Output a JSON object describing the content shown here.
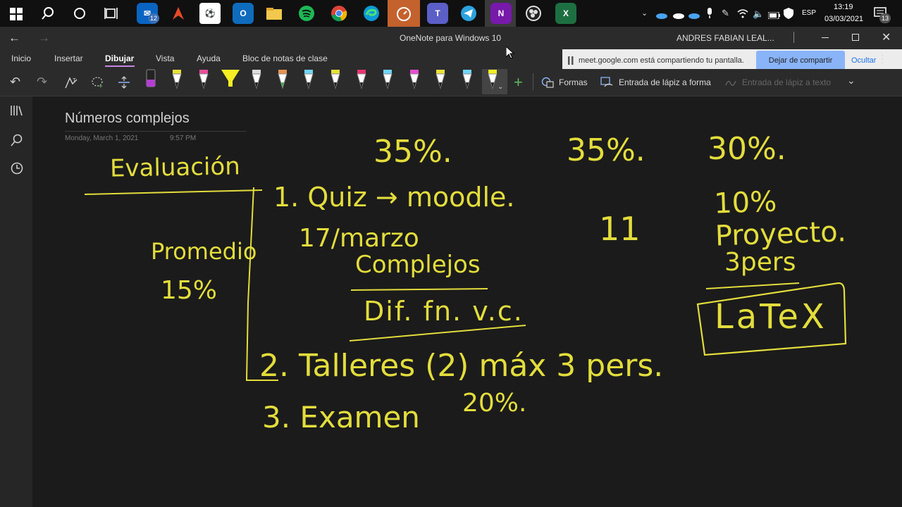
{
  "taskbar": {
    "clock_time": "13:19",
    "clock_date": "03/03/2021",
    "language": "ESP",
    "mail_badge": "12",
    "notif_badge": "13"
  },
  "window": {
    "title": "OneNote para Windows 10",
    "user": "ANDRES FABIAN LEAL..."
  },
  "ribbon": {
    "tabs": [
      "Inicio",
      "Insertar",
      "Dibujar",
      "Vista",
      "Ayuda",
      "Bloc de notas de clase"
    ],
    "active_tab": "Dibujar",
    "shapes_label": "Formas",
    "ink_to_shape_label": "Entrada de lápiz a forma",
    "ink_to_text_label": "Entrada de lápiz a texto"
  },
  "meet_banner": {
    "text": "meet.google.com está compartiendo tu pantalla.",
    "stop_label": "Dejar de compartir",
    "hide_label": "Ocultar"
  },
  "page": {
    "title": "Números complejos",
    "date": "Monday, March 1, 2021",
    "time": "9:57 PM"
  },
  "handwriting": {
    "heading": "Evaluación",
    "average": "Promedio",
    "average_pct": "15%",
    "item1": "1. Quiz → moodle.",
    "item1_date": "17/marzo",
    "item1_topic1": "Complejos",
    "item1_topic2": "Dif. fn. v.c.",
    "item2": "2. Talleres (2) máx 3 pers.",
    "item3": "3. Examen",
    "item3_pct": "20%.",
    "col1_pct": "35%.",
    "col2_pct": "35%.",
    "col2_mark": "11",
    "col3_pct": "30%.",
    "project": "10% Proyecto.",
    "project_people": "3pers",
    "project_tool": "LaTeX"
  },
  "colors": {
    "ink": "#e3dd3c",
    "accent_blue": "#8ab4f8",
    "onenote_purple": "#7719aa"
  }
}
